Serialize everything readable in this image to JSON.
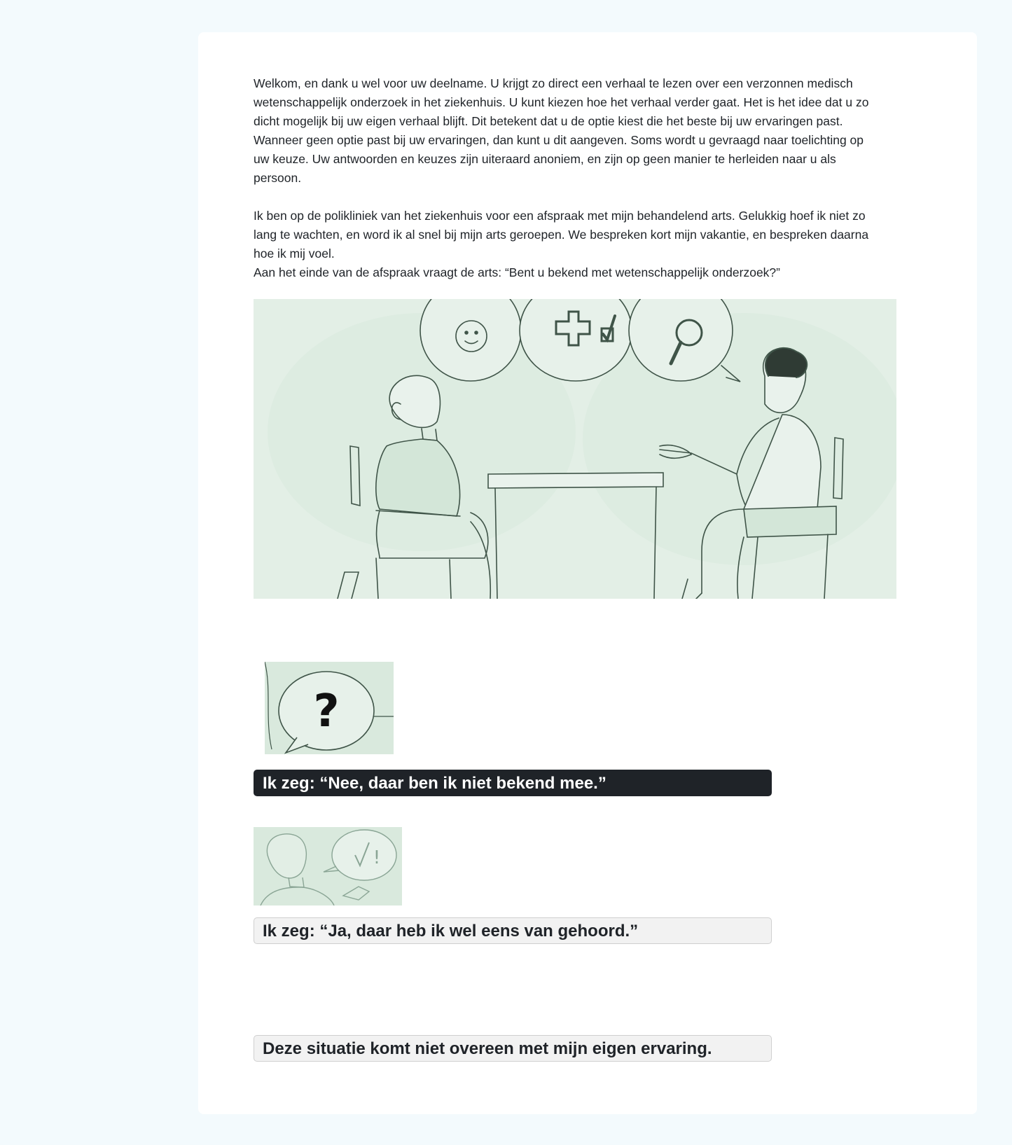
{
  "intro": {
    "welcome": "Welkom, en dank u wel voor uw deelname. U krijgt zo direct een verhaal te lezen  over een verzonnen medisch\nwetenschappelijk onderzoek in het ziekenhuis. U  kunt kiezen hoe het verhaal verder gaat. Het is het idee dat u zo\ndicht mogelijk bij  uw eigen verhaal blijft. Dit betekent dat u de optie kiest die het beste bij uw  ervaringen past.\nWanneer geen optie past bij uw ervaringen, dan kunt u dit  aangeven. Soms wordt u gevraagd naar toelichting op\nuw keuze. Uw antwoorden en keuzes zijn uiteraard anoniem, en zijn op geen manier te herleiden naar u als\npersoon.",
    "story": "Ik ben op de polikliniek van het ziekenhuis voor een afspraak met mijn behandelend  arts. Gelukkig hoef ik niet zo\nlang te wachten, en word ik al snel bij mijn arts  geroepen. We bespreken kort mijn vakantie, en bespreken daarna\nhoe ik mij voel.",
    "question": "Aan het einde van de afspraak vraagt de arts: “Bent u bekend met wetenschappelijk  onderzoek?”"
  },
  "colors": {
    "page_bg": "#f3fafd",
    "card_bg": "#ffffff",
    "illustration_bg": "#e3efe6",
    "sketch": "#3f5448",
    "selected_bg": "#1f2328",
    "option_bg": "#f2f2f2"
  },
  "illustration": {
    "bubble_symbols": [
      "?",
      "?"
    ]
  },
  "options": [
    {
      "id": "no",
      "label": "Ik zeg: “Nee, daar ben ik niet  bekend mee.”",
      "selected": true,
      "icon": "question-bubble-icon",
      "icon_text": "?"
    },
    {
      "id": "yes",
      "label": "Ik zeg: “Ja, daar heb ik wel eens van gehoord.”",
      "selected": false,
      "icon": "check-bubble-icon",
      "icon_text": "!"
    },
    {
      "id": "none",
      "label": "Deze situatie komt niet overeen met mijn eigen ervaring.",
      "selected": false
    }
  ]
}
